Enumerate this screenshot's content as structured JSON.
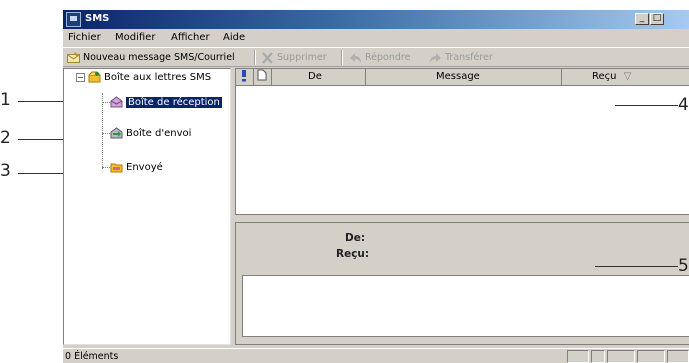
{
  "window": {
    "title": "SMS",
    "min_glyph": "_",
    "max_glyph": "□"
  },
  "menu": [
    {
      "label": "Fichier"
    },
    {
      "label": "Modifier"
    },
    {
      "label": "Afficher"
    },
    {
      "label": "Aide"
    }
  ],
  "toolbar": {
    "new_message": "Nouveau message SMS/Courriel",
    "delete": "Supprimer",
    "reply": "Répondre",
    "forward": "Transférer"
  },
  "tree": {
    "root": "Boîte aux lettres SMS",
    "expander": "⊟",
    "items": [
      {
        "label": "Boîte de réception",
        "selected": true
      },
      {
        "label": "Boîte d'envoi"
      },
      {
        "label": "Envoyé"
      }
    ]
  },
  "list": {
    "columns": [
      {
        "label": ""
      },
      {
        "label": ""
      },
      {
        "label": "De"
      },
      {
        "label": "Message"
      },
      {
        "label": "Reçu"
      }
    ],
    "sort_glyph": "▽"
  },
  "preview": {
    "from_label": "De:",
    "received_label": "Reçu:"
  },
  "status": {
    "text": "0 Éléments"
  },
  "callouts": [
    "1",
    "2",
    "3",
    "4",
    "5"
  ],
  "colors": {
    "titlebar": "#0a246a",
    "selection": "#0a246a",
    "chrome": "#d4d0c8"
  }
}
